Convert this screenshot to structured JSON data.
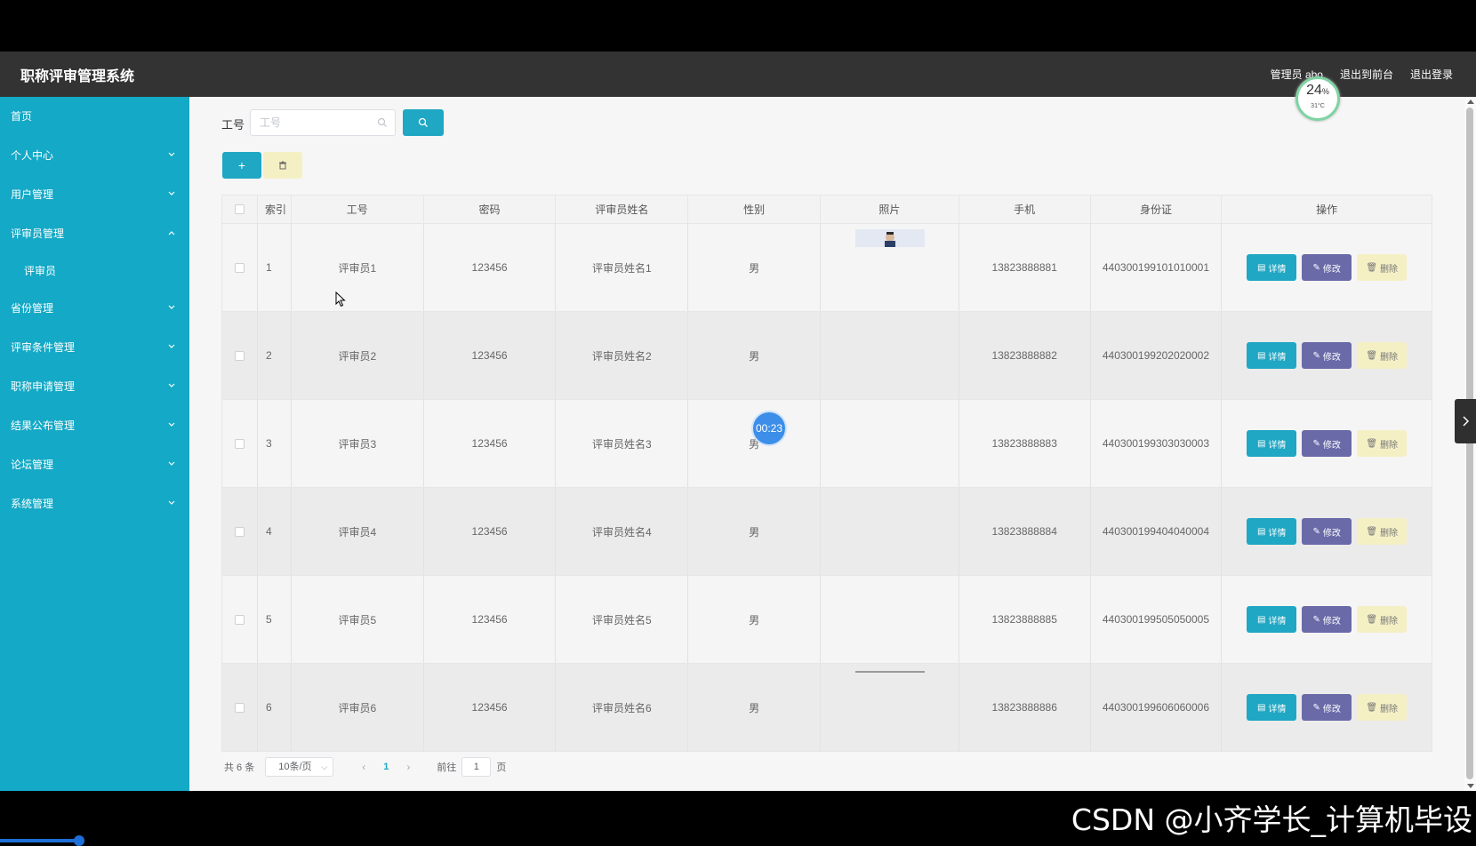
{
  "app": {
    "title": "职称评审管理系统",
    "admin_label": "管理员 abo",
    "back_front": "退出到前台",
    "logout": "退出登录"
  },
  "sidebar": {
    "items": [
      {
        "label": "首页",
        "expandable": false
      },
      {
        "label": "个人中心",
        "expandable": true,
        "expanded": false
      },
      {
        "label": "用户管理",
        "expandable": true,
        "expanded": false
      },
      {
        "label": "评审员管理",
        "expandable": true,
        "expanded": true,
        "children": [
          "评审员"
        ]
      },
      {
        "label": "省份管理",
        "expandable": true,
        "expanded": false
      },
      {
        "label": "评审条件管理",
        "expandable": true,
        "expanded": false
      },
      {
        "label": "职称申请管理",
        "expandable": true,
        "expanded": false
      },
      {
        "label": "结果公布管理",
        "expandable": true,
        "expanded": false
      },
      {
        "label": "论坛管理",
        "expandable": true,
        "expanded": false
      },
      {
        "label": "系统管理",
        "expandable": true,
        "expanded": false
      }
    ]
  },
  "search": {
    "label": "工号",
    "placeholder": "工号",
    "value": ""
  },
  "toolbar": {
    "add_label": "+"
  },
  "table": {
    "columns": [
      "索引",
      "工号",
      "密码",
      "评审员姓名",
      "性别",
      "照片",
      "手机",
      "身份证",
      "操作"
    ],
    "rows": [
      {
        "index": "1",
        "id": "评审员1",
        "password": "123456",
        "name": "评审员姓名1",
        "gender": "男",
        "phone": "13823888881",
        "idcard": "440300199101010001"
      },
      {
        "index": "2",
        "id": "评审员2",
        "password": "123456",
        "name": "评审员姓名2",
        "gender": "男",
        "phone": "13823888882",
        "idcard": "440300199202020002"
      },
      {
        "index": "3",
        "id": "评审员3",
        "password": "123456",
        "name": "评审员姓名3",
        "gender": "男",
        "phone": "13823888883",
        "idcard": "440300199303030003"
      },
      {
        "index": "4",
        "id": "评审员4",
        "password": "123456",
        "name": "评审员姓名4",
        "gender": "男",
        "phone": "13823888884",
        "idcard": "440300199404040004"
      },
      {
        "index": "5",
        "id": "评审员5",
        "password": "123456",
        "name": "评审员姓名5",
        "gender": "男",
        "phone": "13823888885",
        "idcard": "440300199505050005"
      },
      {
        "index": "6",
        "id": "评审员6",
        "password": "123456",
        "name": "评审员姓名6",
        "gender": "男",
        "phone": "13823888886",
        "idcard": "440300199606060006"
      }
    ],
    "actions": {
      "detail": "详情",
      "edit": "修改",
      "delete": "删除"
    }
  },
  "pagination": {
    "total": "共 6 条",
    "page_size": "10条/页",
    "current_page": "1",
    "goto_label": "前往",
    "goto_value": "1",
    "page_suffix": "页"
  },
  "overlay": {
    "weather_percent": "24",
    "weather_percent_sign": "%",
    "weather_temp": "31°C",
    "timer": "00:23",
    "watermark": "CSDN @小齐学长_计算机毕设"
  },
  "colors": {
    "sidebar": "#14a9c6",
    "topbar": "#333333",
    "primary": "#1fa7c3",
    "edit": "#6a6aa9",
    "delete": "#f5f0c4"
  }
}
